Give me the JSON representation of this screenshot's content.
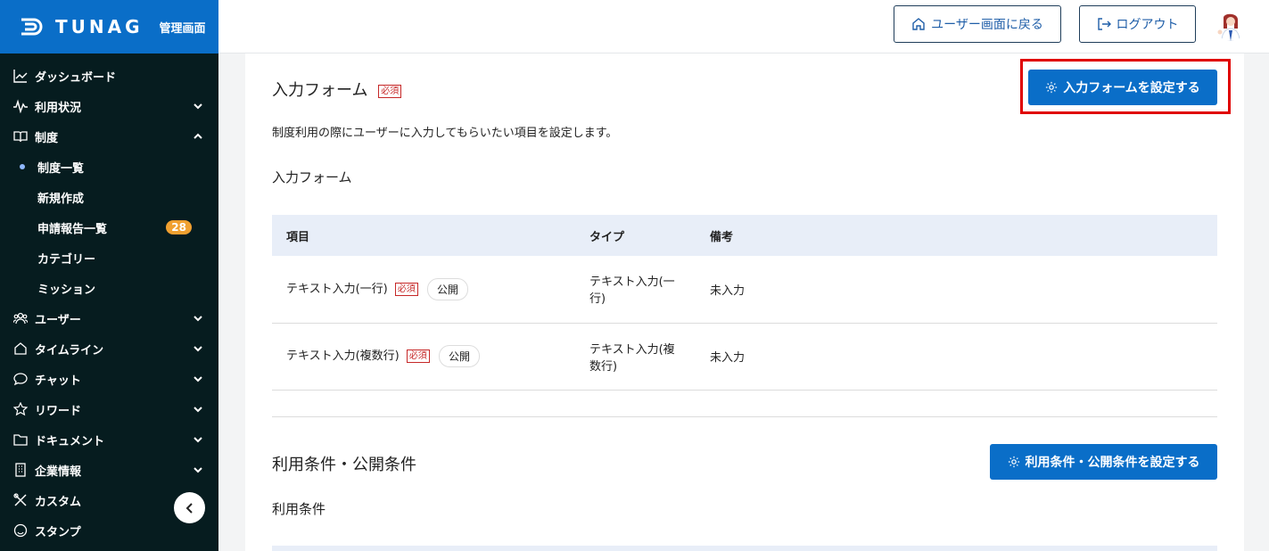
{
  "brand": {
    "logo": "TUNAG",
    "subtitle": "管理画面"
  },
  "sidebar": {
    "items": [
      {
        "label": "ダッシュボード",
        "icon": "chart-icon",
        "chevron": ""
      },
      {
        "label": "利用状況",
        "icon": "pulse-icon",
        "chevron": "down"
      },
      {
        "label": "制度",
        "icon": "book-icon",
        "chevron": "up"
      }
    ],
    "sub_items": [
      {
        "label": "制度一覧",
        "active": true,
        "badge": ""
      },
      {
        "label": "新規作成",
        "active": false,
        "badge": ""
      },
      {
        "label": "申請報告一覧",
        "active": false,
        "badge": "28"
      },
      {
        "label": "カテゴリー",
        "active": false,
        "badge": ""
      },
      {
        "label": "ミッション",
        "active": false,
        "badge": ""
      }
    ],
    "items_after": [
      {
        "label": "ユーザー",
        "icon": "users-icon",
        "chevron": "down"
      },
      {
        "label": "タイムライン",
        "icon": "home-icon",
        "chevron": "down"
      },
      {
        "label": "チャット",
        "icon": "chat-icon",
        "chevron": "down"
      },
      {
        "label": "リワード",
        "icon": "star-icon",
        "chevron": "down"
      },
      {
        "label": "ドキュメント",
        "icon": "folder-icon",
        "chevron": "down"
      },
      {
        "label": "企業情報",
        "icon": "building-icon",
        "chevron": "down"
      },
      {
        "label": "カスタム",
        "icon": "tools-icon",
        "chevron": ""
      },
      {
        "label": "スタンプ",
        "icon": "smile-icon",
        "chevron": ""
      }
    ]
  },
  "header": {
    "back_label": "ユーザー画面に戻る",
    "logout_label": "ログアウト"
  },
  "form_section": {
    "title": "入力フォーム",
    "required": "必須",
    "button": "入力フォームを設定する",
    "description": "制度利用の際にユーザーに入力してもらいたい項目を設定します。",
    "subtitle": "入力フォーム",
    "columns": [
      "項目",
      "タイプ",
      "備考"
    ],
    "rows": [
      {
        "item": "テキスト入力(一行)",
        "required": "必須",
        "visibility": "公開",
        "type_line1": "テキスト入力(一",
        "type_line2": "行)",
        "note": "未入力"
      },
      {
        "item": "テキスト入力(複数行)",
        "required": "必須",
        "visibility": "公開",
        "type_line1": "テキスト入力(複",
        "type_line2": "数行)",
        "note": "未入力"
      }
    ]
  },
  "conditions_section": {
    "title": "利用条件・公開条件",
    "button": "利用条件・公開条件を設定する",
    "subtitle": "利用条件"
  },
  "colors": {
    "brand": "#0a6ec8",
    "sidebar": "#061c1f",
    "required": "#c62828",
    "highlight": "#e00000"
  }
}
